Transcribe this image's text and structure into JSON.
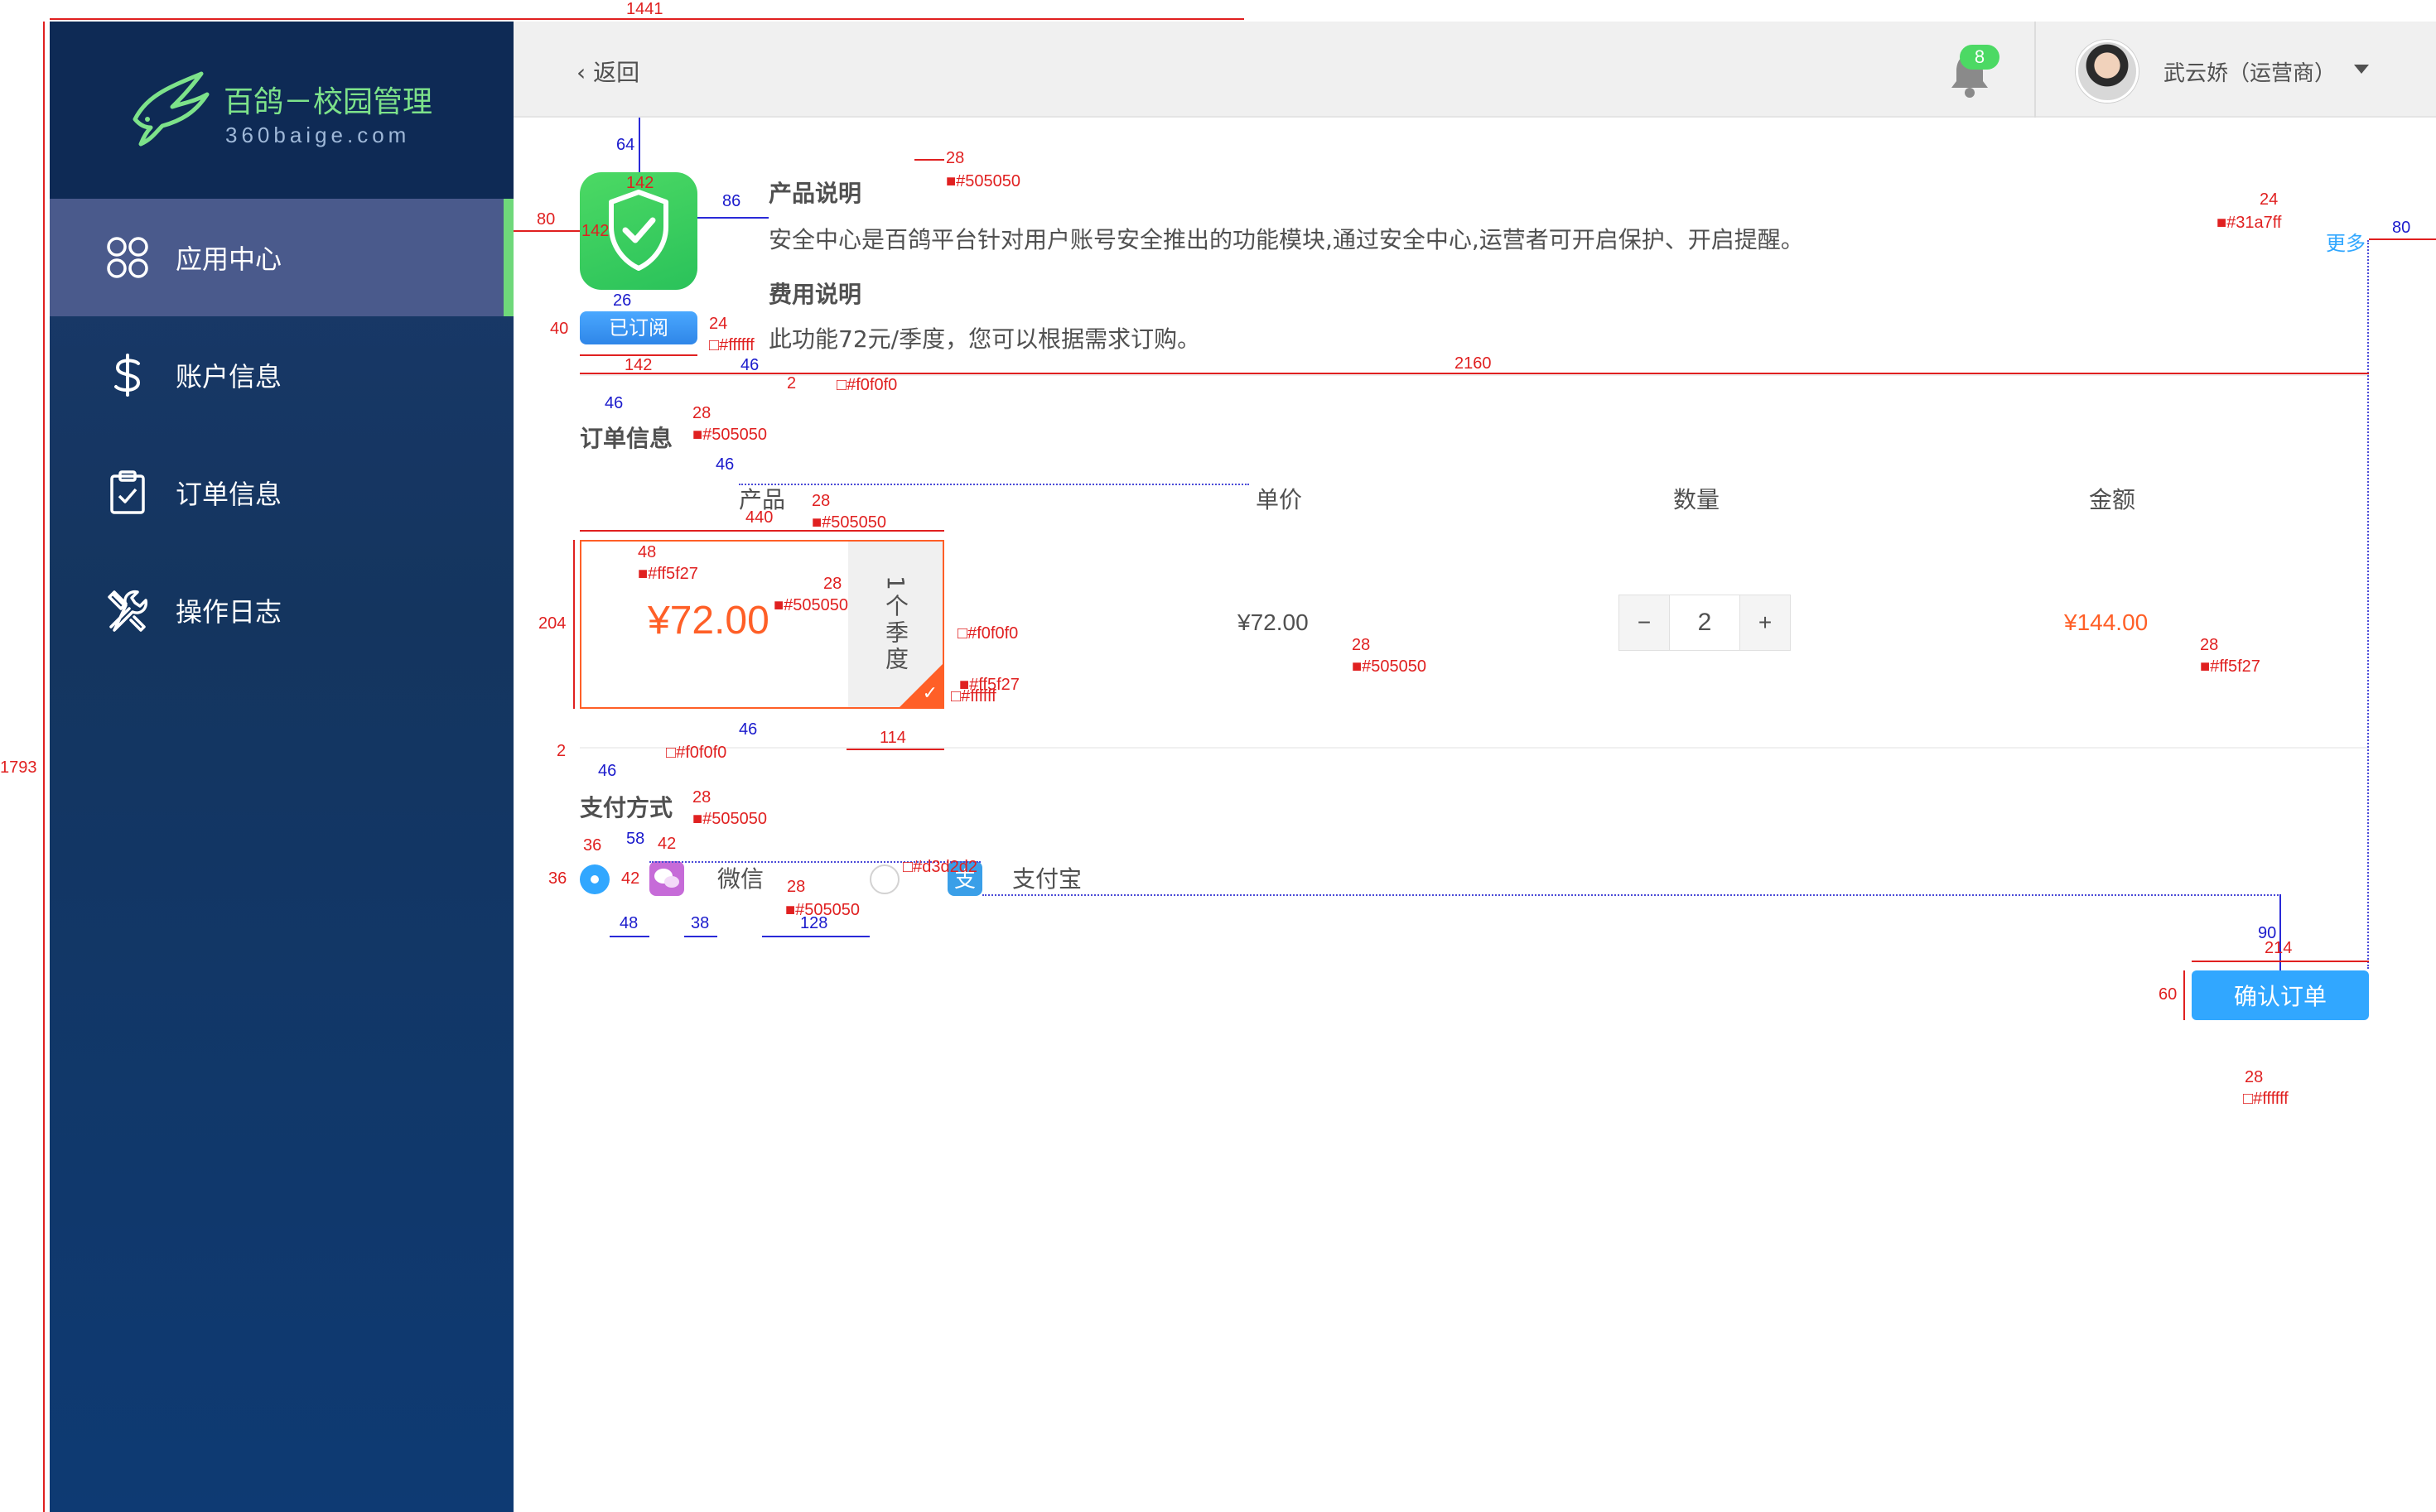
{
  "app": {
    "logo_title": "百鸽－校园管理",
    "logo_sub": "360baige.com"
  },
  "sidebar": {
    "items": [
      {
        "label": "应用中心",
        "icon": "app-grid-icon",
        "active": true
      },
      {
        "label": "账户信息",
        "icon": "dollar-icon",
        "active": false
      },
      {
        "label": "订单信息",
        "icon": "clipboard-check-icon",
        "active": false
      },
      {
        "label": "操作日志",
        "icon": "tools-icon",
        "active": false
      }
    ],
    "active_color": "#6fd87a"
  },
  "header": {
    "back_label": "返回",
    "notification_count": "8",
    "user_name": "武云娇（运营商）"
  },
  "product": {
    "intro_title": "产品说明",
    "intro_text": "安全中心是百鸽平台针对用户账号安全推出的功能模块,通过安全中心,运营者可开启保护、开启提醒。",
    "fee_title": "费用说明",
    "fee_text": "此功能72元/季度，您可以根据需求订购。",
    "subscribed_label": "已订阅",
    "more_label": "更多",
    "icon": "shield-check-icon"
  },
  "order": {
    "section_title": "订单信息",
    "columns": [
      "产品",
      "单价",
      "数量",
      "金额"
    ],
    "item": {
      "price": "¥72.00",
      "period": "1个季度",
      "unit_price": "¥72.00",
      "quantity": "2",
      "amount": "¥144.00"
    },
    "minus_label": "−",
    "plus_label": "+"
  },
  "payment": {
    "section_title": "支付方式",
    "options": [
      {
        "label": "微信",
        "selected": true,
        "icon": "wechat-icon"
      },
      {
        "label": "支付宝",
        "selected": false,
        "icon": "alipay-icon"
      }
    ]
  },
  "actions": {
    "confirm_label": "确认订单"
  },
  "colors": {
    "text": "#505050",
    "accent_orange": "#ff5f27",
    "accent_blue": "#31a7ff",
    "separator": "#f0f0f0",
    "radio_off": "#d3d2d2",
    "white": "#ffffff"
  },
  "annotations": {
    "total_width": "1441",
    "total_height": "1793",
    "icon_top": "64",
    "icon_size": "142",
    "icon_left": "80",
    "icon_gap": "86",
    "title_size": "28",
    "text_color": "■#505050",
    "more_size": "24",
    "more_color": "■#31a7ff",
    "more_right": "80",
    "btn_height": "40",
    "btn_gap": "26",
    "btn_font": "24",
    "btn_color": "□#ffffff",
    "btn_width": "142",
    "sep_gap": "46",
    "sep_height": "2",
    "sep_color": "□#f0f0f0",
    "sep_width": "2160",
    "order_gap": "46",
    "order_title_size": "28",
    "col_gap": "46",
    "col_size": "28",
    "card_width": "440",
    "card_height": "204",
    "price_size": "48",
    "price_color": "■#ff5f27",
    "period_size": "28",
    "period_color": "■#505050",
    "card_border": "□#f0f0f0",
    "corner_color": "■#ff5f27",
    "corner_tick": "□#ffffff",
    "period_width": "114",
    "card_gap": "46",
    "unit_size": "28",
    "amount_size": "28",
    "amount_color": "■#ff5f27",
    "sep2": "2",
    "pay_gap": "46",
    "pay_title_size": "28",
    "radio_size": "36",
    "radio_gap": "58",
    "icon42": "42",
    "radio_off_color": "□#d3d2d2",
    "label_size": "28",
    "label_width": "128",
    "gap48": "48",
    "gap38": "38",
    "confirm_gap": "90",
    "confirm_width": "214",
    "confirm_height": "60",
    "confirm_font": "28",
    "confirm_color": "□#ffffff"
  }
}
